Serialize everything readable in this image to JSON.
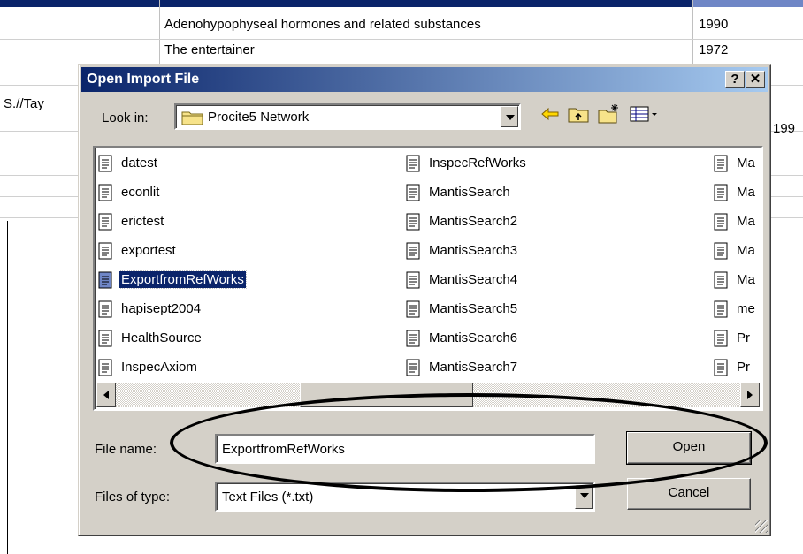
{
  "background": {
    "rows": [
      {
        "title": "Adenohypophyseal hormones and related substances",
        "year": "1990"
      },
      {
        "title": "The entertainer",
        "year": "1972"
      }
    ],
    "left_cell": "S.//Tay",
    "right_cell": "199"
  },
  "dialog": {
    "title": "Open Import File",
    "help_label": "?",
    "close_label": "✕",
    "look_in": {
      "label": "Look in:",
      "value": "Procite5 Network"
    },
    "toolbar": [
      "back-icon",
      "up-folder-icon",
      "new-folder-icon",
      "view-menu-icon"
    ],
    "files": {
      "column1": [
        "datest",
        "econlit",
        "erictest",
        "exportest",
        "ExportfromRefWorks",
        "hapisept2004",
        "HealthSource",
        "InspecAxiom"
      ],
      "column2": [
        "InspecRefWorks",
        "MantisSearch",
        "MantisSearch2",
        "MantisSearch3",
        "MantisSearch4",
        "MantisSearch5",
        "MantisSearch6",
        "MantisSearch7"
      ],
      "column3": [
        "Ma",
        "Ma",
        "Ma",
        "Ma",
        "Ma",
        "me",
        "Pr",
        "Pr"
      ],
      "selected": "ExportfromRefWorks"
    },
    "file_name": {
      "label": "File name:",
      "value": "ExportfromRefWorks"
    },
    "file_type": {
      "label": "Files of type:",
      "value": "Text Files (*.txt)"
    },
    "buttons": {
      "open": "Open",
      "cancel": "Cancel"
    }
  },
  "colors": {
    "titlebar": "#0a246a",
    "selection": "#0a246a",
    "dialog_face": "#d4d0c8"
  }
}
